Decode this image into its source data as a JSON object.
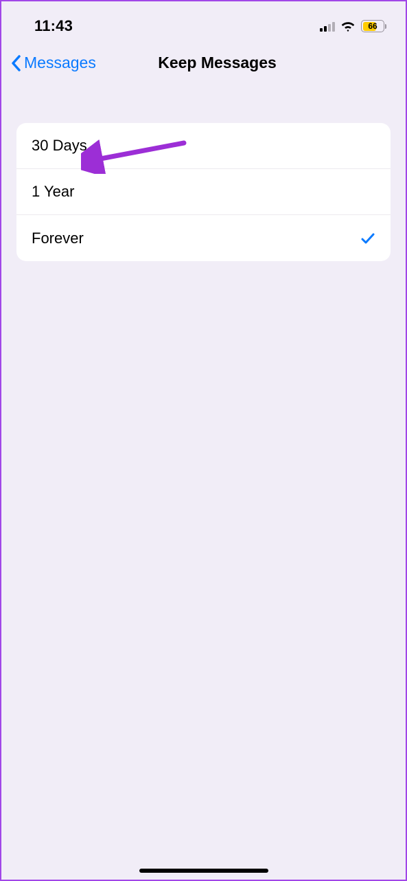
{
  "status_bar": {
    "time": "11:43",
    "battery_pct": "66"
  },
  "nav": {
    "back_label": "Messages",
    "title": "Keep Messages"
  },
  "options": [
    {
      "label": "30 Days",
      "selected": false
    },
    {
      "label": "1 Year",
      "selected": false
    },
    {
      "label": "Forever",
      "selected": true
    }
  ],
  "colors": {
    "accent_blue": "#0a7aff",
    "annotation_purple": "#9c2ed6",
    "battery_yellow": "#ffcc00",
    "background": "#f1edf7"
  }
}
